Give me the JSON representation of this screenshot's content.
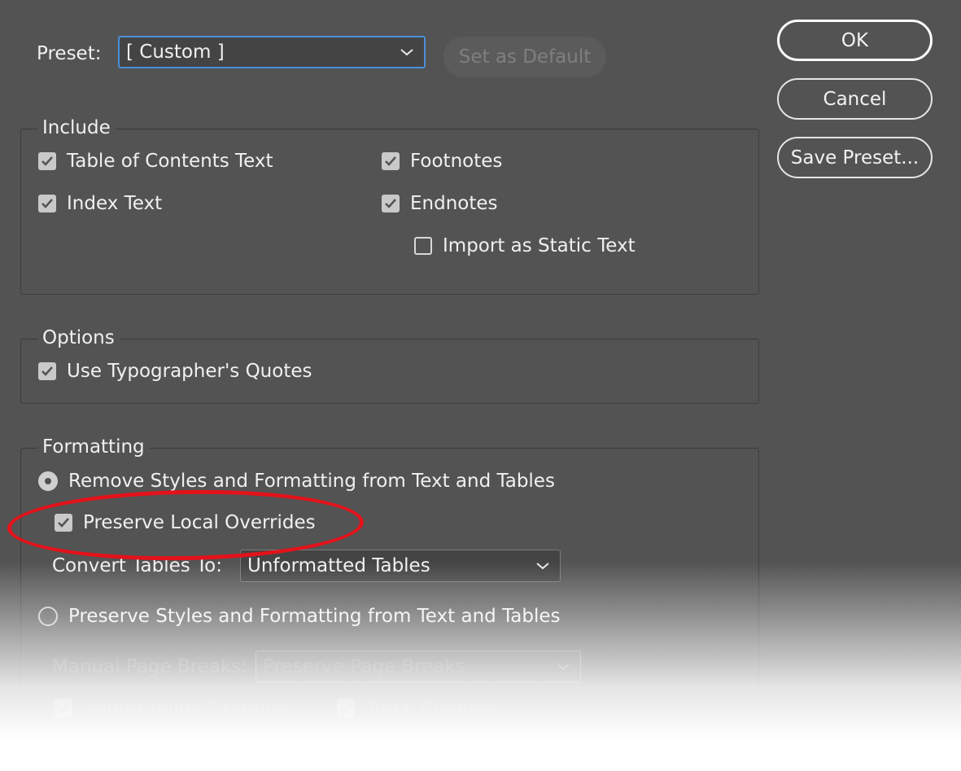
{
  "preset": {
    "label": "Preset:",
    "value": "[ Custom ]",
    "set_default_label": "Set as Default"
  },
  "buttons": {
    "ok": "OK",
    "cancel": "Cancel",
    "save_preset": "Save Preset..."
  },
  "include": {
    "title": "Include",
    "toc_text": {
      "label": "Table of Contents Text",
      "checked": true
    },
    "index_text": {
      "label": "Index Text",
      "checked": true
    },
    "footnotes": {
      "label": "Footnotes",
      "checked": true
    },
    "endnotes": {
      "label": "Endnotes",
      "checked": true
    },
    "static_text": {
      "label": "Import as Static Text",
      "checked": false
    }
  },
  "options": {
    "title": "Options",
    "typographers_quotes": {
      "label": "Use Typographer's Quotes",
      "checked": true
    }
  },
  "formatting": {
    "title": "Formatting",
    "remove_styles": {
      "label": "Remove Styles and Formatting from Text and Tables",
      "selected": true
    },
    "preserve_overrides": {
      "label": "Preserve Local Overrides",
      "checked": true
    },
    "convert_tables_label": "Convert Tables To:",
    "convert_tables_value": "Unformatted Tables",
    "preserve_styles": {
      "label": "Preserve Styles and Formatting from Text and Tables",
      "selected": false
    },
    "page_breaks_label": "Manual Page Breaks:",
    "page_breaks_value": "Preserve Page Breaks",
    "inline_graphics": {
      "label": "Import Inline Graphics",
      "checked": true
    },
    "track_changes": {
      "label": "Track Changes",
      "checked": true
    }
  },
  "colors": {
    "dialog_bg": "#535353",
    "focus_ring": "#4a8fd8",
    "highlight": "#e3121a"
  }
}
